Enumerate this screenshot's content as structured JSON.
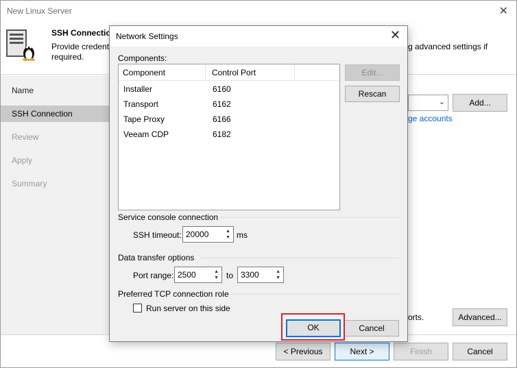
{
  "wizard": {
    "title": "New Linux Server",
    "step_title": "SSH Connection",
    "step_desc": "Provide credenti",
    "step_desc_cont": "required.",
    "step_desc_right": "g advanced settings if",
    "nav": [
      "Name",
      "SSH Connection",
      "Review",
      "Apply",
      "Summary"
    ],
    "add_label": "Add...",
    "manage_link": "ge accounts",
    "ports_text": "orts.",
    "advanced_label": "Advanced...",
    "previous_label": "< Previous",
    "next_label": "Next >",
    "finish_label": "Finish",
    "cancel_label": "Cancel"
  },
  "dialog": {
    "title": "Network Settings",
    "components_label": "Components:",
    "columns": [
      "Component",
      "Control Port"
    ],
    "rows": [
      {
        "component": "Installer",
        "port": "6160"
      },
      {
        "component": "Transport",
        "port": "6162"
      },
      {
        "component": "Tape Proxy",
        "port": "6166"
      },
      {
        "component": "Veeam CDP",
        "port": "6182"
      }
    ],
    "edit_label": "Edit...",
    "rescan_label": "Rescan",
    "service_console_label": "Service console connection",
    "ssh_timeout_label": "SSH timeout:",
    "ssh_timeout_value": "20000",
    "ms_label": "ms",
    "data_transfer_label": "Data transfer options",
    "port_range_label": "Port range:",
    "port_from": "2500",
    "to_label": "to",
    "port_to": "3300",
    "tcp_role_label": "Preferred TCP connection role",
    "run_server_label": "Run server on this side",
    "run_server_checked": false,
    "ok_label": "OK",
    "cancel_label": "Cancel"
  },
  "colors": {
    "highlight": "#d9232e",
    "accent": "#0078d7",
    "link": "#0066cc"
  }
}
